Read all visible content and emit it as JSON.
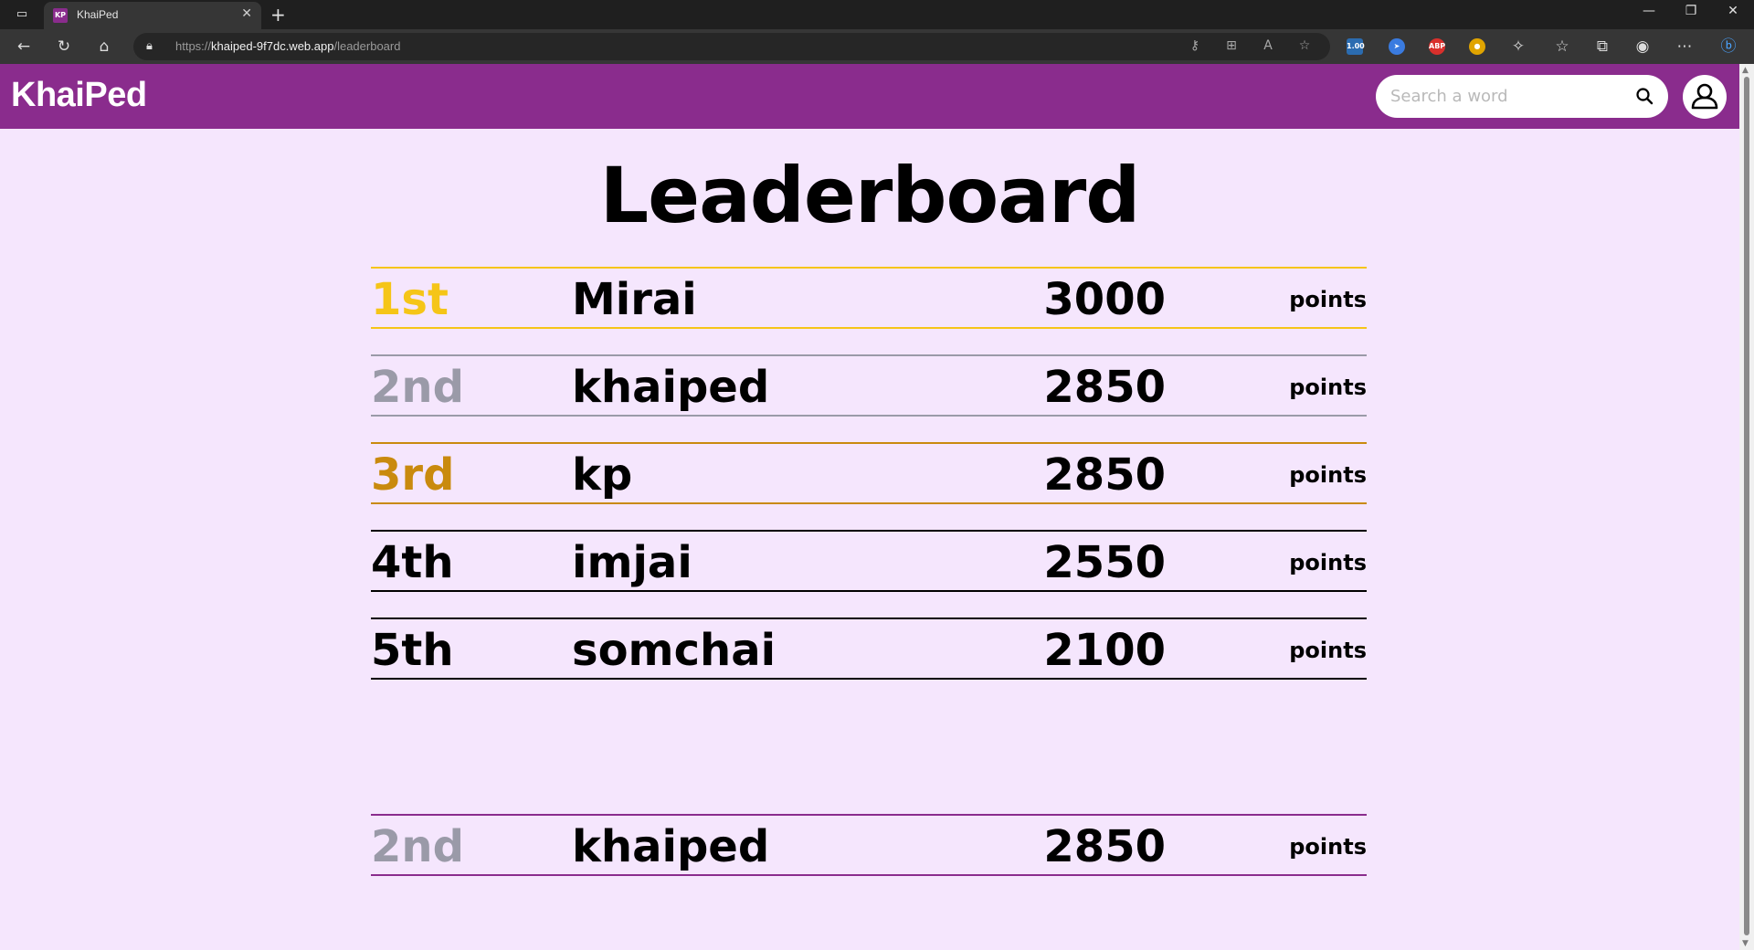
{
  "browser": {
    "tab_title": "KhaiPed",
    "tab_favicon_text": "KP",
    "url_prefix": "https://",
    "url_host": "khaiped-9f7dc.web.app",
    "url_path": "/leaderboard",
    "extension_badge": "1.00",
    "abp_label": "ABP"
  },
  "header": {
    "logo": "KhaiPed",
    "search_placeholder": "Search a word"
  },
  "page": {
    "title": "Leaderboard"
  },
  "colors": {
    "brand_purple": "#8a2c8d",
    "page_bg": "#f5e6fd",
    "gold": "#f5c518",
    "silver": "#9a9aa8",
    "bronze": "#c98a0e",
    "default": "#000000"
  },
  "leaderboard": [
    {
      "rank": "1st",
      "name": "Mirai",
      "score": "3000",
      "unit": "points",
      "tier": "gold"
    },
    {
      "rank": "2nd",
      "name": "khaiped",
      "score": "2850",
      "unit": "points",
      "tier": "silver"
    },
    {
      "rank": "3rd",
      "name": "kp",
      "score": "2850",
      "unit": "points",
      "tier": "bronze"
    },
    {
      "rank": "4th",
      "name": "imjai",
      "score": "2550",
      "unit": "points",
      "tier": "default"
    },
    {
      "rank": "5th",
      "name": "somchai",
      "score": "2100",
      "unit": "points",
      "tier": "default"
    }
  ],
  "current_user": {
    "rank": "2nd",
    "name": "khaiped",
    "score": "2850",
    "unit": "points",
    "tier": "silver"
  }
}
